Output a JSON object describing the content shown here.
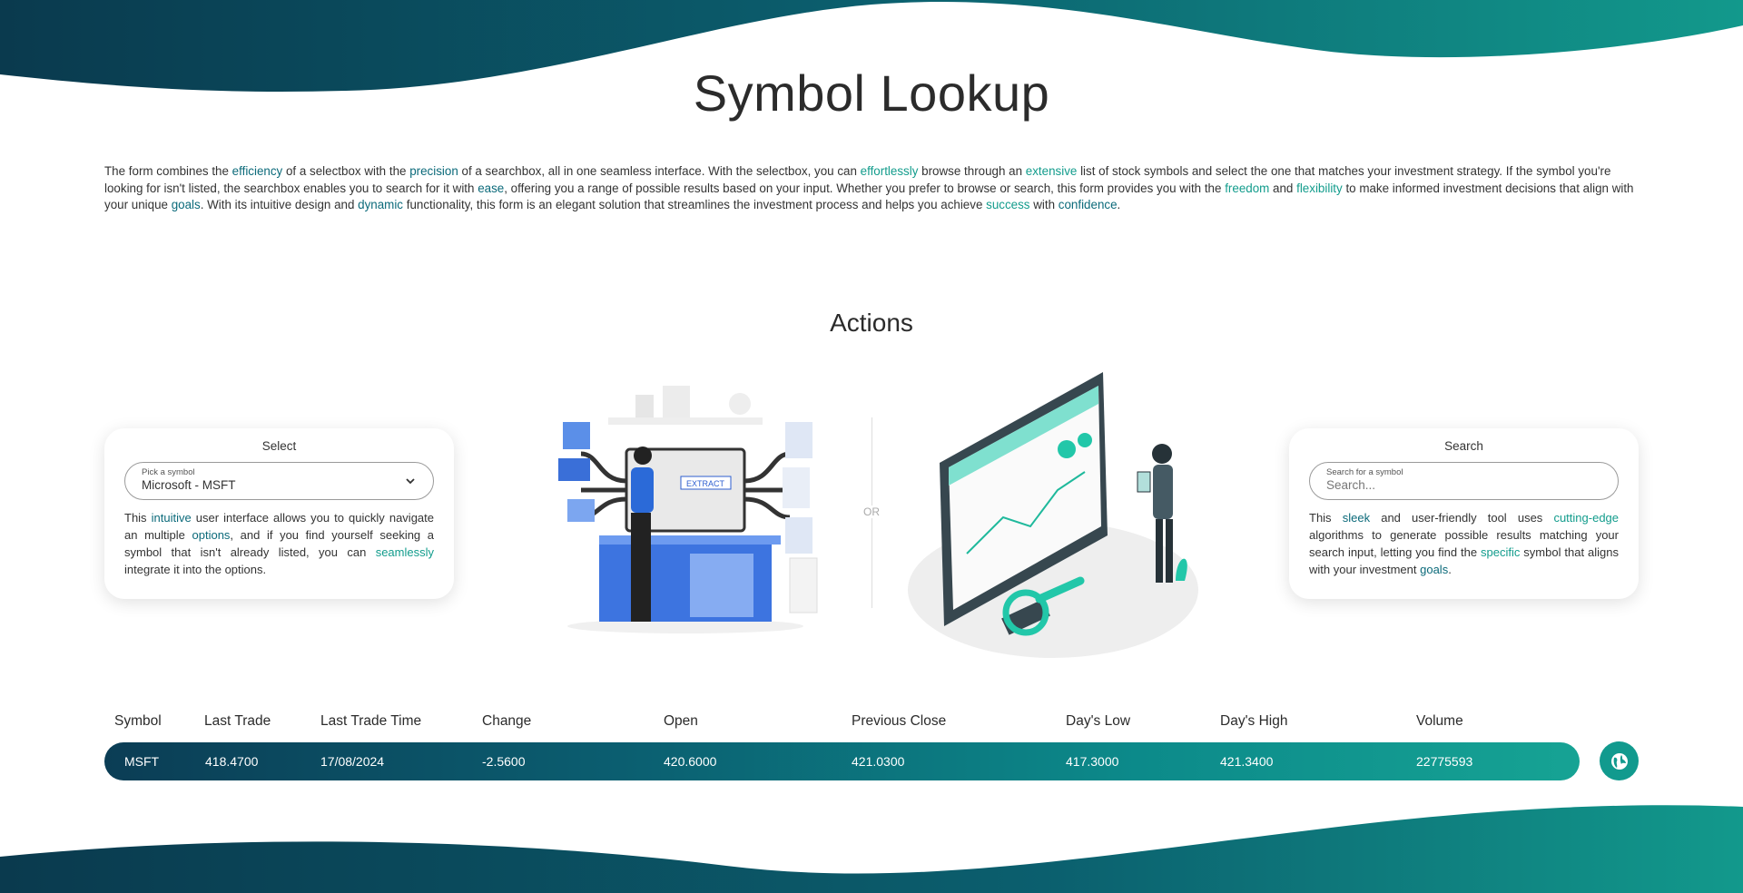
{
  "title": "Symbol Lookup",
  "intro": [
    {
      "t": "The form combines the "
    },
    {
      "t": "efficiency",
      "h": 1
    },
    {
      "t": " of a selectbox with the "
    },
    {
      "t": "precision",
      "h": 1
    },
    {
      "t": " of a searchbox, all in one seamless interface. With the selectbox, you can "
    },
    {
      "t": "effortlessly",
      "h": 2
    },
    {
      "t": " browse through an "
    },
    {
      "t": "extensive",
      "h": 2
    },
    {
      "t": " list of stock symbols and select the one that matches your investment strategy. If the symbol you're looking for isn't listed, the searchbox enables you to search for it with "
    },
    {
      "t": "ease",
      "h": 1
    },
    {
      "t": ", offering you a range of possible results based on your input. Whether you prefer to browse or search, this form provides you with the "
    },
    {
      "t": "freedom",
      "h": 2
    },
    {
      "t": " and "
    },
    {
      "t": "flexibility",
      "h": 2
    },
    {
      "t": " to make informed investment decisions that align with your unique "
    },
    {
      "t": "goals",
      "h": 1
    },
    {
      "t": ". With its intuitive design and "
    },
    {
      "t": "dynamic",
      "h": 1
    },
    {
      "t": " functionality, this form is an elegant solution that streamlines the investment process and helps you achieve "
    },
    {
      "t": "success",
      "h": 2
    },
    {
      "t": " with "
    },
    {
      "t": "confidence",
      "h": 1
    },
    {
      "t": "."
    }
  ],
  "actions_title": "Actions",
  "or_label": "OR",
  "select_card": {
    "title": "Select",
    "field_label": "Pick a symbol",
    "field_value": "Microsoft - MSFT",
    "text": [
      {
        "t": "This "
      },
      {
        "t": "intuitive",
        "h": 1
      },
      {
        "t": " user interface allows you to quickly navigate an multiple "
      },
      {
        "t": "options",
        "h": 1
      },
      {
        "t": ", and if you find yourself seeking a symbol that isn't already listed, you can "
      },
      {
        "t": "seamlessly",
        "h": 2
      },
      {
        "t": " integrate it into the options."
      }
    ]
  },
  "search_card": {
    "title": "Search",
    "field_label": "Search for a symbol",
    "placeholder": "Search...",
    "text": [
      {
        "t": "This "
      },
      {
        "t": "sleek",
        "h": 1
      },
      {
        "t": " and user-friendly tool uses "
      },
      {
        "t": "cutting-edge",
        "h": 2
      },
      {
        "t": " algorithms to generate possible results matching your search input, letting you find the "
      },
      {
        "t": "specific",
        "h": 2
      },
      {
        "t": " symbol that aligns with your investment "
      },
      {
        "t": "goals",
        "h": 1
      },
      {
        "t": "."
      }
    ]
  },
  "illustration_label": "EXTRACT",
  "table": {
    "headers": [
      "Symbol",
      "Last Trade",
      "Last Trade Time",
      "Change",
      "Open",
      "Previous Close",
      "Day's Low",
      "Day's High",
      "Volume"
    ],
    "row": [
      "MSFT",
      "418.4700",
      "17/08/2024",
      "-2.5600",
      "420.6000",
      "421.0300",
      "417.3000",
      "421.3400",
      "22775593"
    ]
  },
  "colors": {
    "accent": "#119a8e",
    "dark": "#0b3d55",
    "highlight": "#0b6a7a"
  }
}
